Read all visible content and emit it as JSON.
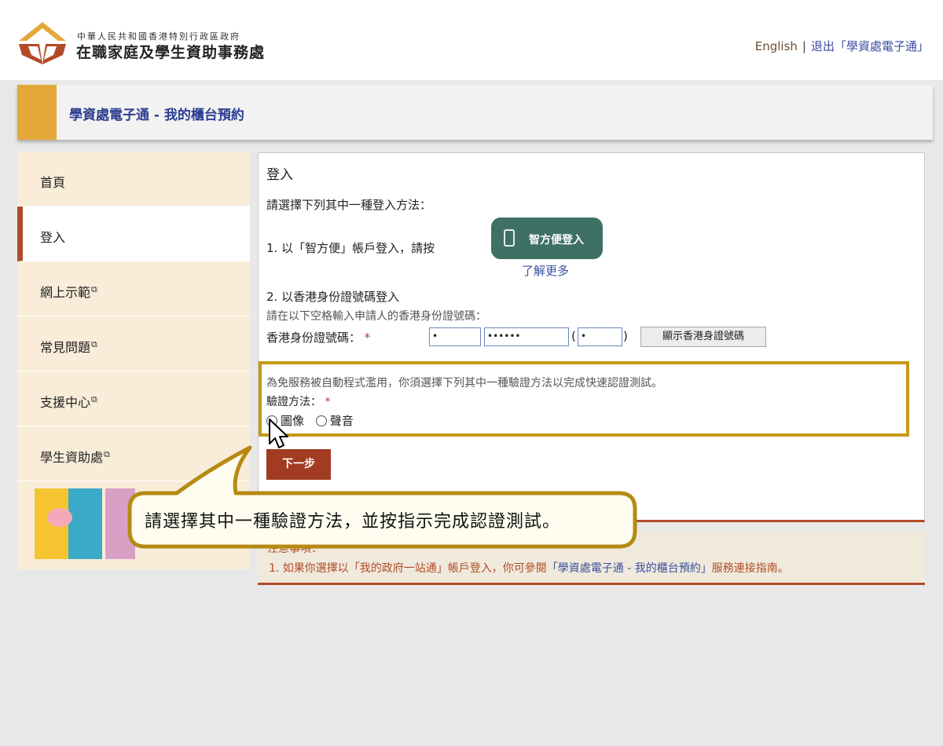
{
  "header": {
    "org_line1": "中華人民共和國香港特別行政區政府",
    "org_line2": "在職家庭及學生資助事務處",
    "lang_link": "English",
    "separator": "|",
    "logout_link": "退出「學資處電子通」"
  },
  "page_title": "學資處電子通 - 我的櫃台預約",
  "sidebar": {
    "items": [
      {
        "label": "首頁",
        "external": false
      },
      {
        "label": "登入",
        "external": false,
        "active": true
      },
      {
        "label": "網上示範",
        "external": true
      },
      {
        "label": "常見問題",
        "external": true
      },
      {
        "label": "支援中心",
        "external": true
      },
      {
        "label": "學生資助處",
        "external": true
      }
    ],
    "external_icon": "external-link-icon"
  },
  "login": {
    "heading": "登入",
    "choose_method": "請選擇下列其中一種登入方法：",
    "method1": "1. 以「智方便」帳戶登入，請按",
    "iam_smart_button": "智方便登入",
    "learn_more": "了解更多",
    "method2_title": "2. 以香港身份證號碼登入",
    "method2_hint": "請在以下空格輸入申請人的香港身份證號碼：",
    "hkid_label": "香港身份證號碼：",
    "required_mark": "*",
    "hkid_prefix_value": "•",
    "hkid_digits_value": "••••••",
    "hkid_check_value": "•",
    "paren_open": "(",
    "paren_close": ")",
    "show_hkid_button": "顯示香港身證號碼"
  },
  "captcha": {
    "notice": "為免服務被自動程式濫用，你須選擇下列其中一種驗證方法以完成快速認證測試。",
    "label": "驗證方法：",
    "option_image": "圖像",
    "option_audio": "聲音"
  },
  "next_button": "下一步",
  "notes": {
    "heading": "注意事項：",
    "item1_prefix": "1. 如果你選擇以「我的政府一站通」帳戶登入，你可參閱",
    "item1_link": "「學資處電子通 - 我的櫃台預約」",
    "item1_suffix": "服務連接指南。"
  },
  "callout": {
    "text": "請選擇其中一種驗證方法，並按指示完成認證測試。"
  },
  "colors": {
    "accent_gold": "#e4a83a",
    "brand_red": "#b24b28",
    "link_blue": "#3a4ea0",
    "iam_green": "#3e7065",
    "callout_border": "#b68a12"
  }
}
